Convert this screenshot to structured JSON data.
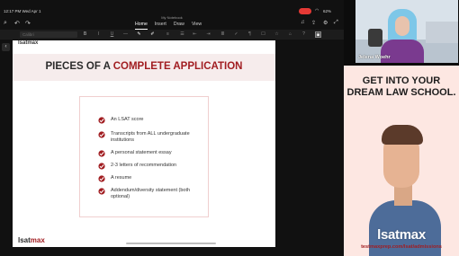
{
  "status": {
    "time": "12:17 PM  Wed Apr 1",
    "battery": "62%",
    "wifi_icon": "wifi-icon"
  },
  "document": {
    "title": "My Notebook"
  },
  "menu": [
    "Home",
    "Insert",
    "Draw",
    "View"
  ],
  "font_field": {
    "value": "Calibri"
  },
  "slide": {
    "top_logo": "lsatmax",
    "title_part1": "PIECES OF A ",
    "title_part2": "COMPLETE APPLICATION",
    "items": [
      "An LSAT score",
      "Transcripts from ALL undergraduate institutions",
      "A personal statement essay",
      "2-3 letters of recommendation",
      "A resume",
      "Addendum/diversity statement (both optional)"
    ],
    "footer_logo_part1": "lsat",
    "footer_logo_part2": "max"
  },
  "participant": {
    "name": "Jelena Woehr"
  },
  "ad": {
    "headline": "GET INTO YOUR DREAM LAW SCHOOL.",
    "logo": "lsatmax",
    "url": "testmaxprep.com/lsat/admissions"
  },
  "colors": {
    "accent": "#a11d21",
    "record": "#e53935",
    "ad_bg": "#fde7e2"
  }
}
